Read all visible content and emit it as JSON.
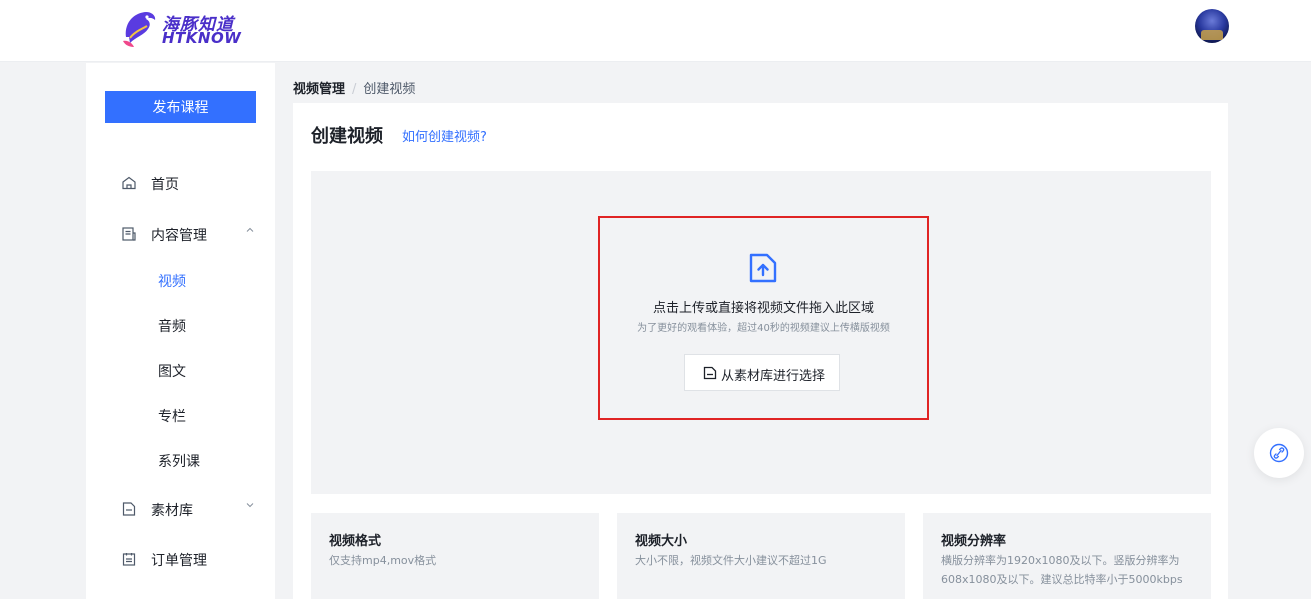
{
  "header": {
    "logo_cn": "海豚知道",
    "logo_en": "HTKNOW"
  },
  "sidebar": {
    "publish_label": "发布课程",
    "items": [
      {
        "label": "首页",
        "icon": "home-icon"
      },
      {
        "label": "内容管理",
        "icon": "content-icon",
        "expanded": true,
        "children": [
          "视频",
          "音频",
          "图文",
          "专栏",
          "系列课"
        ],
        "active_child": "视频"
      },
      {
        "label": "素材库",
        "icon": "material-icon",
        "expanded": false
      },
      {
        "label": "订单管理",
        "icon": "order-icon"
      }
    ]
  },
  "breadcrumb": {
    "parent": "视频管理",
    "separator": "/",
    "current": "创建视频"
  },
  "main": {
    "title": "创建视频",
    "help_link": "如何创建视频?",
    "upload": {
      "primary_text": "点击上传或直接将视频文件拖入此区域",
      "hint_text": "为了更好的观看体验，超过40秒的视频建议上传横版视频",
      "library_button": "从素材库进行选择"
    },
    "specs": [
      {
        "title": "视频格式",
        "desc": "仅支持mp4,mov格式"
      },
      {
        "title": "视频大小",
        "desc": "大小不限，视频文件大小建议不超过1G"
      },
      {
        "title": "视频分辨率",
        "desc": "横版分辨率为1920x1080及以下。竖版分辨率为608x1080及以下。建议总比特率小于5000kbps"
      }
    ]
  },
  "colors": {
    "accent": "#3370ff",
    "highlight_border": "#e02424",
    "logo": "#4a2fc9"
  }
}
